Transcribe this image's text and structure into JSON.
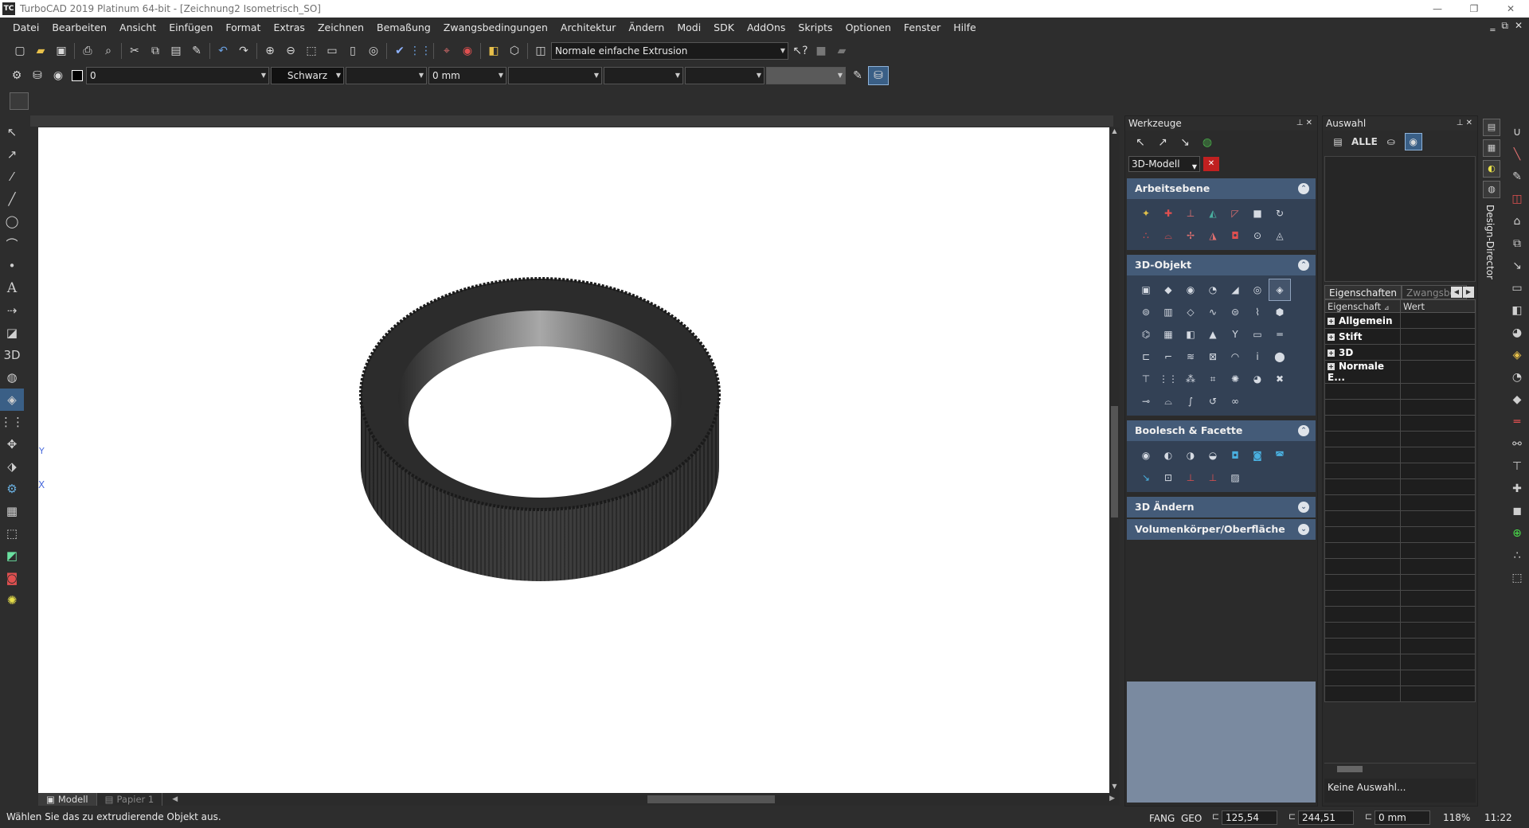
{
  "window": {
    "app_icon": "TC",
    "title": "TurboCAD 2019 Platinum 64-bit - [Zeichnung2 Isometrisch_SO]",
    "controls": [
      "—",
      "❐",
      "✕"
    ],
    "mdi_controls": [
      "‗",
      "⧉",
      "✕"
    ]
  },
  "menu": [
    "Datei",
    "Bearbeiten",
    "Ansicht",
    "Einfügen",
    "Format",
    "Extras",
    "Zeichnen",
    "Bemaßung",
    "Zwangsbedingungen",
    "Architektur",
    "Ändern",
    "Modi",
    "SDK",
    "AddOns",
    "Skripts",
    "Optionen",
    "Fenster",
    "Hilfe"
  ],
  "toolbar1": {
    "extrusion_mode": "Normale einfache Extrusion"
  },
  "toolbar2": {
    "layer_value": "0",
    "color_value": "Schwarz",
    "line_width": "0 mm"
  },
  "canvas": {
    "axis_y": "Y",
    "axis_x": "X",
    "tabs": [
      {
        "label": "Modell",
        "icon": "model-icon"
      },
      {
        "label": "Papier 1",
        "icon": "paper-icon"
      }
    ]
  },
  "werkzeuge": {
    "title": "Werkzeuge",
    "palette": "3D-Modell",
    "sections": [
      {
        "title": "Arbeitsebene"
      },
      {
        "title": "3D-Objekt"
      },
      {
        "title": "Boolesch & Facette"
      },
      {
        "title": "3D Ändern"
      },
      {
        "title": "Volumenkörper/Oberfläche"
      }
    ]
  },
  "auswahl": {
    "title": "Auswahl",
    "all_button": "ALLE",
    "tabs": [
      "Eigenschaften",
      "Zwangsbed"
    ],
    "table_headers": [
      "Eigenschaft",
      "Wert"
    ],
    "properties": [
      "Allgemein",
      "Stift",
      "3D",
      "Normale E..."
    ],
    "status": "Keine Auswahl..."
  },
  "design_director": {
    "label": "Design-Director"
  },
  "statusbar": {
    "prompt": "Wählen Sie das zu extrudierende Objekt aus.",
    "snap1": "FANG",
    "snap2": "GEO",
    "coord_x": "125,54 mm",
    "coord_y": "244,51 mm",
    "coord_z": "0 mm",
    "zoom": "118%",
    "time": "11:22"
  },
  "colors": {
    "background": "#2d2d2d",
    "section_header": "#445b78",
    "section_body": "#334155",
    "active_tool": "#3a5f86"
  }
}
